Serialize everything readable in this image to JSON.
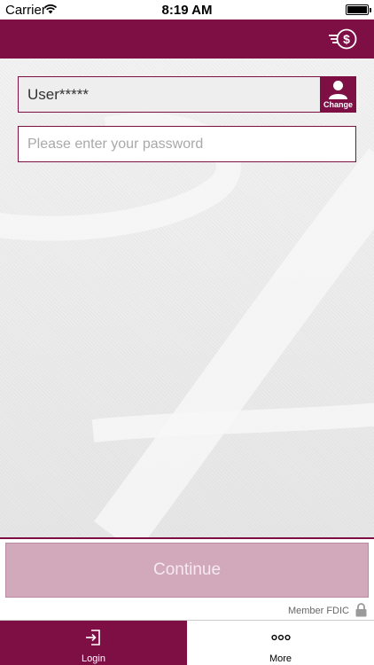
{
  "status_bar": {
    "carrier": "Carrier",
    "time": "8:19 AM"
  },
  "header": {
    "menu_icon": "money-transfer-icon",
    "brand_color": "#7d0f45"
  },
  "login": {
    "username_value": "User*****",
    "change_label": "Change",
    "password_placeholder": "Please enter your password"
  },
  "continue_label": "Continue",
  "footer": {
    "member_text": "Member FDIC"
  },
  "tabs": [
    {
      "label": "Login",
      "icon": "login-icon",
      "active": true
    },
    {
      "label": "More",
      "icon": "more-dots-icon",
      "active": false
    }
  ]
}
